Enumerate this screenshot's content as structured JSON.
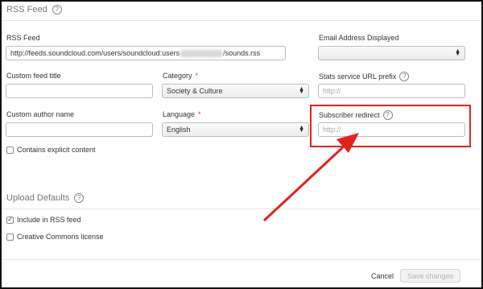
{
  "rss_section": {
    "title": "RSS Feed",
    "help": "?"
  },
  "fields": {
    "rss_feed": {
      "label": "RSS Feed",
      "value_start": "http://feeds.soundcloud.com/users/soundcloud:users",
      "value_end": "/sounds.rss"
    },
    "email": {
      "label": "Email Address Displayed",
      "value": ""
    },
    "custom_title": {
      "label": "Custom feed title",
      "value": ""
    },
    "category": {
      "label": "Category",
      "required_mark": "*",
      "value": "Society & Culture"
    },
    "stats_prefix": {
      "label": "Stats service URL prefix",
      "help": "?",
      "placeholder": "http://"
    },
    "author": {
      "label": "Custom author name",
      "value": ""
    },
    "language": {
      "label": "Language",
      "required_mark": "*",
      "value": "English"
    },
    "subscriber_redirect": {
      "label": "Subscriber redirect",
      "help": "?",
      "placeholder": "http://"
    },
    "explicit": {
      "label": "Contains explicit content",
      "checked": false
    }
  },
  "upload_section": {
    "title": "Upload Defaults",
    "help": "?",
    "include_rss": {
      "label": "Include in RSS feed",
      "checked": true,
      "mark": "✓"
    },
    "creative_commons": {
      "label": "Creative Commons license",
      "checked": false
    }
  },
  "actions": {
    "cancel": "Cancel",
    "save": "Save changes"
  },
  "annotation": {
    "color": "#e0231f"
  }
}
